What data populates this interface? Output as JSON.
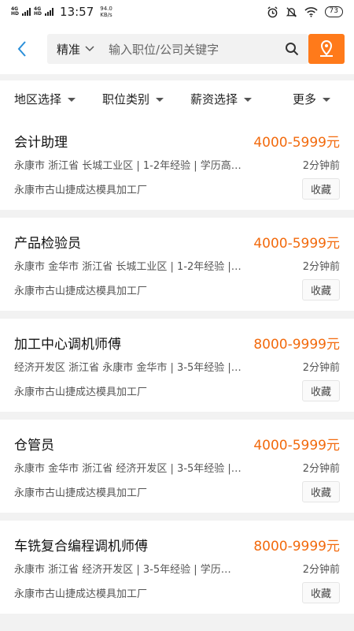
{
  "status": {
    "net1": "4G",
    "net1_sub": "HD",
    "net2": "4G",
    "net2_sub": "HD",
    "time": "13:57",
    "speed_value": "94.0",
    "speed_unit": "KB/s",
    "battery": "73"
  },
  "header": {
    "mode_label": "精准",
    "search_placeholder": "输入职位/公司关键字"
  },
  "filters": [
    {
      "label": "地区选择"
    },
    {
      "label": "职位类别"
    },
    {
      "label": "薪资选择"
    },
    {
      "label": "更多"
    }
  ],
  "jobs": [
    {
      "title": "会计助理",
      "salary": "4000-5999元",
      "info": "永康市 浙江省 长城工业区 | 1-2年经验 | 学历高…",
      "time": "2分钟前",
      "company": "永康市古山捷成达模具加工厂",
      "fav": "收藏"
    },
    {
      "title": "产品检验员",
      "salary": "4000-5999元",
      "info": "永康市 金华市 浙江省 长城工业区 | 1-2年经验 |…",
      "time": "2分钟前",
      "company": "永康市古山捷成达模具加工厂",
      "fav": "收藏"
    },
    {
      "title": "加工中心调机师傅",
      "salary": "8000-9999元",
      "info": "经济开发区 浙江省 永康市 金华市 | 3-5年经验 |…",
      "time": "2分钟前",
      "company": "永康市古山捷成达模具加工厂",
      "fav": "收藏"
    },
    {
      "title": "仓管员",
      "salary": "4000-5999元",
      "info": "永康市 金华市 浙江省 经济开发区 | 3-5年经验 |…",
      "time": "2分钟前",
      "company": "永康市古山捷成达模具加工厂",
      "fav": "收藏"
    },
    {
      "title": "车铣复合编程调机师傅",
      "salary": "8000-9999元",
      "info": "永康市 浙江省 经济开发区 | 3-5年经验 | 学历…",
      "time": "2分钟前",
      "company": "永康市古山捷成达模具加工厂",
      "fav": "收藏"
    }
  ],
  "colors": {
    "accent": "#ff7a1a",
    "salary": "#f26a0d",
    "back": "#2a8fd9"
  }
}
